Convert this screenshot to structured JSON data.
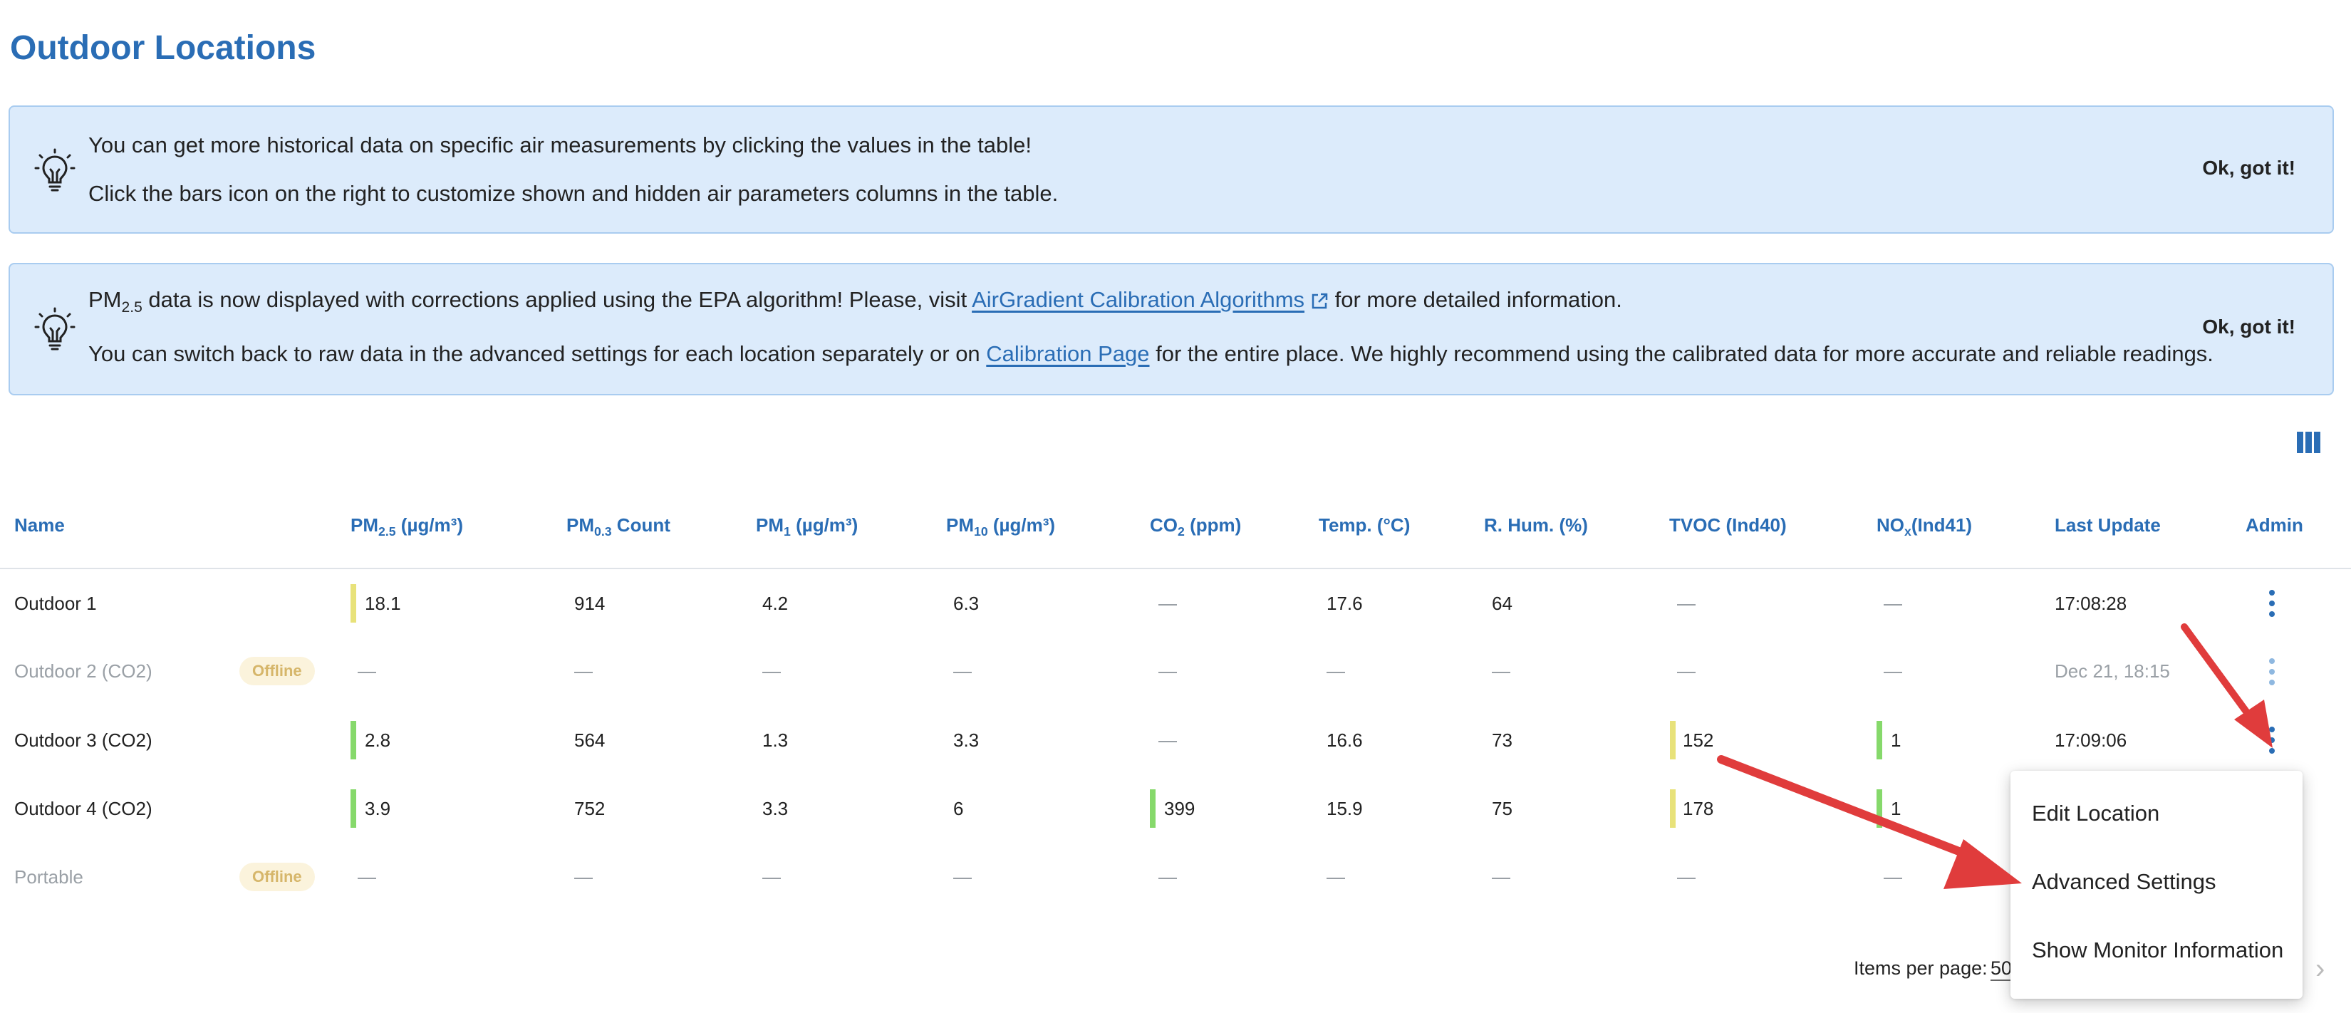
{
  "page": {
    "title": "Outdoor Locations"
  },
  "banners": [
    {
      "line1": "You can get more historical data on specific air measurements by clicking the values in the table!",
      "line2": "Click the bars icon on the right to customize shown and hidden air parameters columns in the table.",
      "ok_label": "Ok, got it!"
    },
    {
      "line1_pm": "PM",
      "line1_pm_sub": "2.5",
      "line1_before_link": " data is now displayed with corrections applied using the EPA algorithm! Please, visit ",
      "line1_link": "AirGradient Calibration Algorithms",
      "line1_after_link": " for more detailed information.",
      "line2_before_link": "You can switch back to raw data in the advanced settings for each location separately or on ",
      "line2_link": "Calibration Page",
      "line2_after_link": " for the entire place. We highly recommend using the calibrated data for more accurate and reliable readings.",
      "ok_label": "Ok, got it!"
    }
  ],
  "table": {
    "columns": {
      "name": "Name",
      "pm25_a": "PM",
      "pm25_sub": "2.5",
      "pm25_b": " (µg/m³)",
      "pm03_a": "PM",
      "pm03_sub": "0.3",
      "pm03_b": " Count",
      "pm1_a": "PM",
      "pm1_sub": "1",
      "pm1_b": " (µg/m³)",
      "pm10_a": "PM",
      "pm10_sub": "10",
      "pm10_b": " (µg/m³)",
      "co2_a": "CO",
      "co2_sub": "2",
      "co2_b": " (ppm)",
      "temp": "Temp. (°C)",
      "hum": "R. Hum. (%)",
      "tvoc": "TVOC (Ind40)",
      "nox_a": "NO",
      "nox_sub": "x",
      "nox_b": "(Ind41)",
      "last_update": "Last Update",
      "admin": "Admin"
    },
    "rows": [
      {
        "name": "Outdoor 1",
        "status": "",
        "pm25": "18.1",
        "pm03": "914",
        "pm1": "4.2",
        "pm10": "6.3",
        "co2": "",
        "temp": "17.6",
        "hum": "64",
        "tvoc": "",
        "nox": "",
        "last_update": "17:08:28"
      },
      {
        "name": "Outdoor 2 (CO2)",
        "status": "Offline",
        "pm25": "",
        "pm03": "",
        "pm1": "",
        "pm10": "",
        "co2": "",
        "temp": "",
        "hum": "",
        "tvoc": "",
        "nox": "",
        "last_update": "Dec 21, 18:15"
      },
      {
        "name": "Outdoor 3 (CO2)",
        "status": "",
        "pm25": "2.8",
        "pm03": "564",
        "pm1": "1.3",
        "pm10": "3.3",
        "co2": "",
        "temp": "16.6",
        "hum": "73",
        "tvoc": "152",
        "nox": "1",
        "last_update": "17:09:06"
      },
      {
        "name": "Outdoor 4 (CO2)",
        "status": "",
        "pm25": "3.9",
        "pm03": "752",
        "pm1": "3.3",
        "pm10": "6",
        "co2": "399",
        "temp": "15.9",
        "hum": "75",
        "tvoc": "178",
        "nox": "1",
        "last_update": ""
      },
      {
        "name": "Portable",
        "status": "Offline",
        "pm25": "",
        "pm03": "",
        "pm1": "",
        "pm10": "",
        "co2": "",
        "temp": "",
        "hum": "",
        "tvoc": "",
        "nox": "",
        "last_update": ""
      }
    ]
  },
  "context_menu": {
    "items": [
      "Edit Location",
      "Advanced Settings",
      "Show Monitor Information"
    ]
  },
  "pagination": {
    "items_per_page_label": "Items per page:",
    "items_per_page_value": "50"
  },
  "colors": {
    "accent": "#2a6db5",
    "banner_bg": "#dcebfb",
    "indicator_yellow": "#e8e27a",
    "indicator_green": "#86d96b",
    "annotation_arrow": "#e03c3c"
  },
  "icons": {
    "banner": "lightbulb-icon",
    "columns": "columns-icon",
    "admin": "kebab-menu-icon",
    "external": "external-link-icon",
    "next": "chevron-right-icon"
  }
}
